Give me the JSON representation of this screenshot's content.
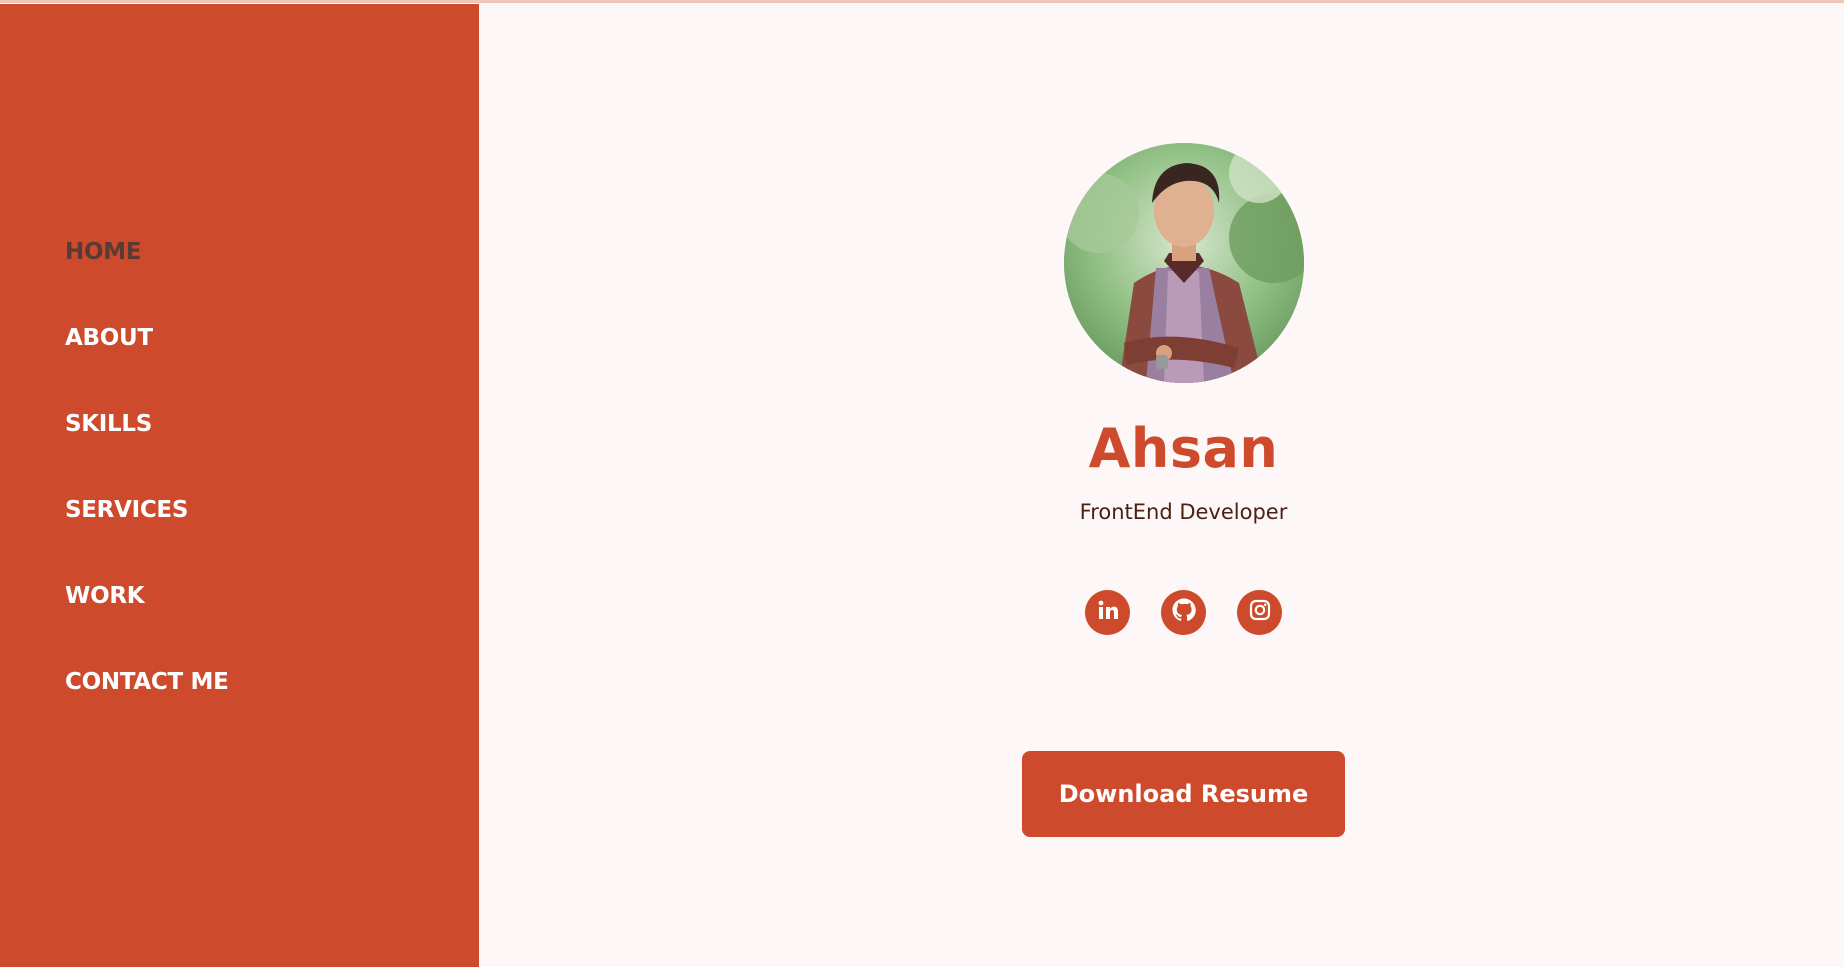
{
  "nav": {
    "items": [
      {
        "label": "HOME",
        "active": true
      },
      {
        "label": "ABOUT",
        "active": false
      },
      {
        "label": "SKILLS",
        "active": false
      },
      {
        "label": "SERVICES",
        "active": false
      },
      {
        "label": "WORK",
        "active": false
      },
      {
        "label": "CONTACT ME",
        "active": false
      }
    ]
  },
  "profile": {
    "name": "Ahsan",
    "role": "FrontEnd Developer"
  },
  "social": [
    {
      "icon": "linkedin-icon"
    },
    {
      "icon": "github-icon"
    },
    {
      "icon": "instagram-icon"
    }
  ],
  "actions": {
    "download_label": "Download Resume"
  },
  "colors": {
    "accent": "#cd4a2c",
    "background": "#fdf8f7",
    "nav_active": "#5a3a34",
    "role_text": "#4a1f14"
  }
}
